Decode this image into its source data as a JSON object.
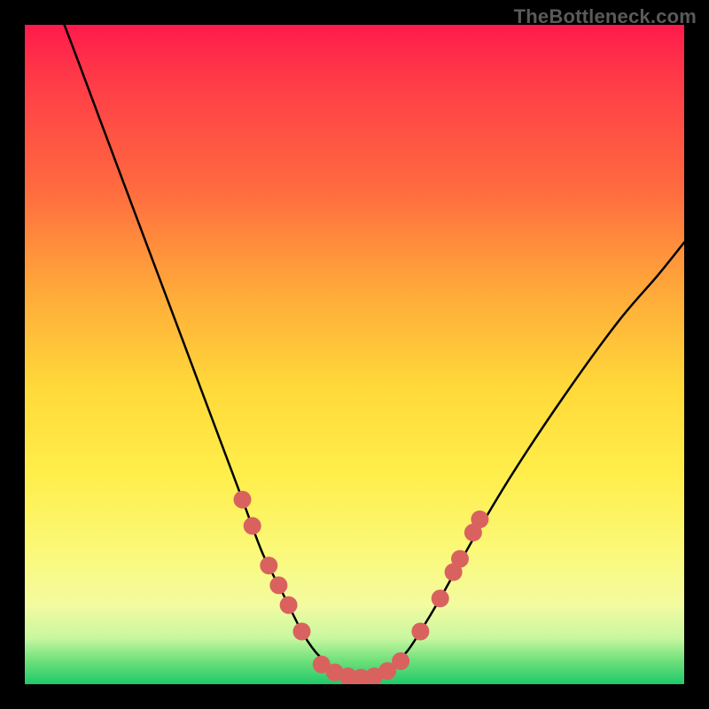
{
  "watermark": "TheBottleneck.com",
  "chart_data": {
    "type": "line",
    "title": "",
    "xlabel": "",
    "ylabel": "",
    "xlim": [
      0,
      100
    ],
    "ylim": [
      0,
      100
    ],
    "series": [
      {
        "name": "bottleneck-curve",
        "x": [
          0,
          6,
          12,
          18,
          24,
          30,
          33,
          36,
          39,
          42,
          44,
          46,
          48,
          50,
          52,
          54,
          56,
          58,
          60,
          63,
          68,
          74,
          82,
          90,
          96,
          100
        ],
        "values": [
          115,
          100,
          84,
          68,
          52,
          36,
          28,
          20,
          14,
          8,
          5,
          3,
          1.5,
          1,
          1,
          1.5,
          3,
          5,
          8,
          13,
          22,
          32,
          44,
          55,
          62,
          67
        ]
      }
    ],
    "markers": {
      "name": "highlight-points",
      "color": "#d9625f",
      "points": [
        {
          "x": 33,
          "y": 28
        },
        {
          "x": 34.5,
          "y": 24
        },
        {
          "x": 37,
          "y": 18
        },
        {
          "x": 38.5,
          "y": 15
        },
        {
          "x": 40,
          "y": 12
        },
        {
          "x": 42,
          "y": 8
        },
        {
          "x": 45,
          "y": 3
        },
        {
          "x": 47,
          "y": 1.8
        },
        {
          "x": 49,
          "y": 1.2
        },
        {
          "x": 51,
          "y": 1
        },
        {
          "x": 53,
          "y": 1.2
        },
        {
          "x": 55,
          "y": 2
        },
        {
          "x": 57,
          "y": 3.5
        },
        {
          "x": 60,
          "y": 8
        },
        {
          "x": 63,
          "y": 13
        },
        {
          "x": 65,
          "y": 17
        },
        {
          "x": 66,
          "y": 19
        },
        {
          "x": 68,
          "y": 23
        },
        {
          "x": 69,
          "y": 25
        }
      ]
    },
    "gradient_colors": {
      "top": "#ff1a4b",
      "mid": "#ffd93a",
      "bottom": "#1fc96a"
    }
  }
}
